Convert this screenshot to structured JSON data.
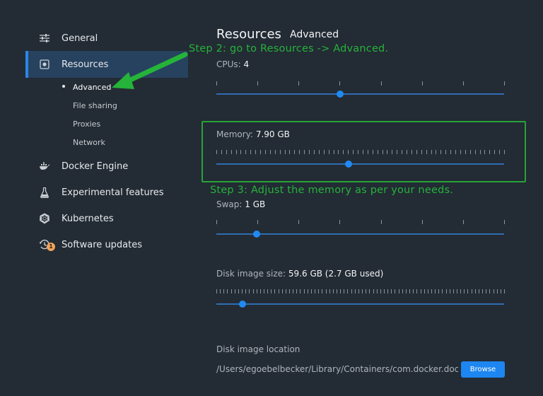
{
  "sidebar": {
    "items": [
      {
        "label": "General",
        "icon": "sliders-icon"
      },
      {
        "label": "Resources",
        "icon": "resources-icon"
      },
      {
        "label": "Docker Engine",
        "icon": "whale-icon"
      },
      {
        "label": "Experimental features",
        "icon": "flask-icon"
      },
      {
        "label": "Kubernetes",
        "icon": "helm-wheel-icon"
      },
      {
        "label": "Software updates",
        "icon": "clock-icon",
        "badge": "1"
      }
    ],
    "sub_items": [
      {
        "label": "Advanced"
      },
      {
        "label": "File sharing"
      },
      {
        "label": "Proxies"
      },
      {
        "label": "Network"
      }
    ]
  },
  "main": {
    "title": "Resources",
    "subtitle": "Advanced",
    "cpus": {
      "label": "CPUs:",
      "value": "4",
      "fraction": 0.43
    },
    "memory": {
      "label": "Memory:",
      "value": "7.90 GB",
      "fraction": 0.46
    },
    "swap": {
      "label": "Swap:",
      "value": "1 GB",
      "fraction": 0.14
    },
    "disk": {
      "label": "Disk image size:",
      "value": "59.6 GB (2.7 GB used)",
      "fraction": 0.09
    },
    "location": {
      "label": "Disk image location",
      "path": "/Users/egoebelbecker/Library/Containers/com.docker.doc",
      "browse_label": "Browse"
    }
  },
  "annotations": {
    "step2": "Step 2: go to Resources -> Advanced.",
    "step3": "Step 3: Adjust the memory as per your needs."
  },
  "colors": {
    "background": "#232b34",
    "accent": "#1f8af2",
    "annotation": "#25b33a",
    "badge": "#f0a35b"
  }
}
